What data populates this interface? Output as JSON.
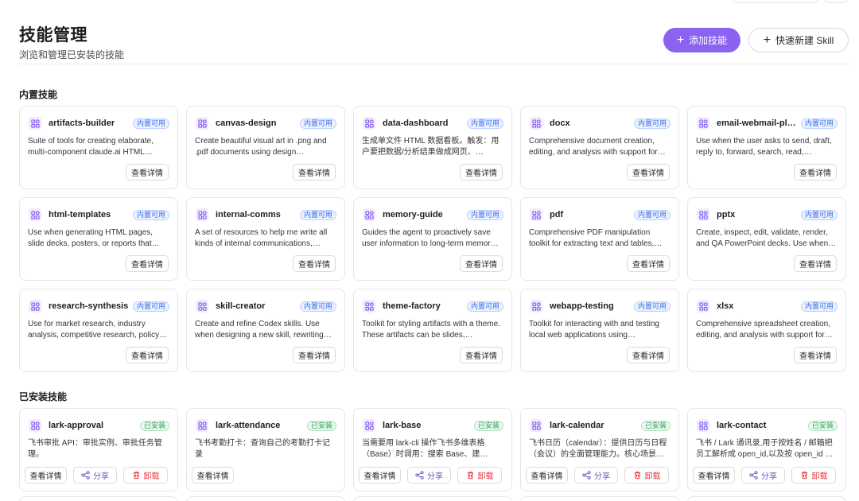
{
  "header": {
    "title": "技能管理",
    "subtitle": "浏览和管理已安装的技能",
    "add_skill_label": "添加技能",
    "quick_create_label": "快速新建 Skill"
  },
  "builtin": {
    "section_title": "内置技能",
    "badge": "内置可用",
    "detail_label": "查看详情",
    "items": [
      {
        "name": "artifacts-builder",
        "desc": "Suite of tools for creating elaborate, multi-component claude.ai HTML…"
      },
      {
        "name": "canvas-design",
        "desc": "Create beautiful visual art in .png and .pdf documents using design…"
      },
      {
        "name": "data-dashboard",
        "desc": "生成单文件 HTML 数据看板。触发：用户要把数据/分析结果做成网页、…"
      },
      {
        "name": "docx",
        "desc": "Comprehensive document creation, editing, and analysis with support for…"
      },
      {
        "name": "email-webmail-pl…",
        "desc": "Use when the user asks to send, draft, reply to, forward, search, read,…"
      },
      {
        "name": "html-templates",
        "desc": "Use when generating HTML pages, slide decks, posters, or reports that…"
      },
      {
        "name": "internal-comms",
        "desc": "A set of resources to help me write all kinds of internal communications,…"
      },
      {
        "name": "memory-guide",
        "desc": "Guides the agent to proactively save user information to long-term memor…"
      },
      {
        "name": "pdf",
        "desc": "Comprehensive PDF manipulation toolkit for extracting text and tables,…"
      },
      {
        "name": "pptx",
        "desc": "Create, inspect, edit, validate, render, and QA PowerPoint decks. Use when…"
      },
      {
        "name": "research-synthesis",
        "desc": "Use for market research, industry analysis, competitive research, policy…"
      },
      {
        "name": "skill-creator",
        "desc": "Create and refine Codex skills. Use when designing a new skill, rewriting…"
      },
      {
        "name": "theme-factory",
        "desc": "Toolkit for styling artifacts with a theme. These artifacts can be slides,…"
      },
      {
        "name": "webapp-testing",
        "desc": "Toolkit for interacting with and testing local web applications using…"
      },
      {
        "name": "xlsx",
        "desc": "Comprehensive spreadsheet creation, editing, and analysis with support for…"
      }
    ]
  },
  "installed": {
    "section_title": "已安装技能",
    "badge": "已安装",
    "detail_label": "查看详情",
    "share_label": "分享",
    "uninstall_label": "卸载",
    "items": [
      {
        "name": "lark-approval",
        "desc": "飞书审批 API：审批实例、审批任务管理。",
        "has_actions": true
      },
      {
        "name": "lark-attendance",
        "desc": "飞书考勤打卡：查询自己的考勤打卡记录",
        "has_actions": false
      },
      {
        "name": "lark-base",
        "desc": "当需要用 lark-cli 操作飞书多维表格（Base）时调用：搜索 Base、建表、…",
        "has_actions": true
      },
      {
        "name": "lark-calendar",
        "desc": "飞书日历（calendar）：提供日历与日程（会议）的全面管理能力。核心场景包…",
        "has_actions": true
      },
      {
        "name": "lark-contact",
        "desc": "飞书 / Lark 通讯录,用于按姓名 / 邮箱把员工解析成 open_id,以及按 open_id 反查…",
        "has_actions": true
      }
    ]
  },
  "colors": {
    "accent": "#8a63f0",
    "builtin_badge": "#3d6ee8",
    "installed_badge": "#2f9e57",
    "danger": "#e0393e"
  }
}
